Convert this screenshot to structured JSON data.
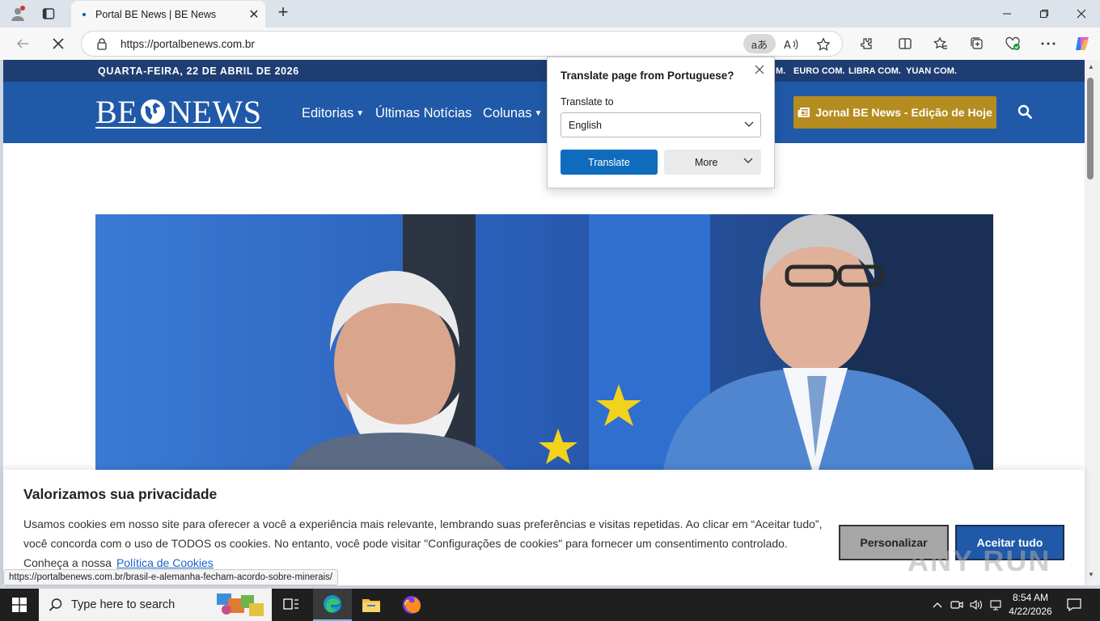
{
  "browser": {
    "tab_title": "Portal BE News | BE News",
    "url": "https://portalbenews.com.br",
    "translate_icon": "aあ"
  },
  "site": {
    "date": "QUARTA-FEIRA, 22 DE ABRIL DE 2026",
    "currencies": [
      "M.",
      "EURO COM.",
      "LIBRA COM.",
      "YUAN COM."
    ],
    "logo_left": "BE",
    "logo_right": "NEWS",
    "menu": [
      {
        "label": "Editorias",
        "has_caret": true
      },
      {
        "label": "Últimas Notícias",
        "has_caret": false
      },
      {
        "label": "Colunas",
        "has_caret": true
      }
    ],
    "jornal_button": "Jornal BE News - Edição de Hoje"
  },
  "translate_popup": {
    "title": "Translate page from Portuguese?",
    "label": "Translate to",
    "selected_language": "English",
    "translate_button": "Translate",
    "more_button": "More"
  },
  "cookie": {
    "title": "Valorizamos sua privacidade",
    "text": "Usamos cookies em nosso site para oferecer a você a experiência mais relevante, lembrando suas preferências e visitas repetidas. Ao clicar em “Aceitar tudo”, você concorda com o uso de TODOS os cookies. No entanto, você pode visitar \"Configurações de cookies\" para fornecer um consentimento controlado. Conheça a nossa",
    "link": "Política de Cookies",
    "personalize": "Personalizar",
    "accept": "Aceitar tudo",
    "watermark": "ANY RUN"
  },
  "status_url": "https://portalbenews.com.br/brasil-e-alemanha-fecham-acordo-sobre-minerais/",
  "taskbar": {
    "search_placeholder": "Type here to search",
    "time": "8:54 AM",
    "date": "4/22/2026"
  },
  "colors": {
    "header_blue": "#2059a8",
    "strip_navy": "#1e3e73",
    "gold": "#b58c1f",
    "edge_blue": "#0f6cbd"
  }
}
